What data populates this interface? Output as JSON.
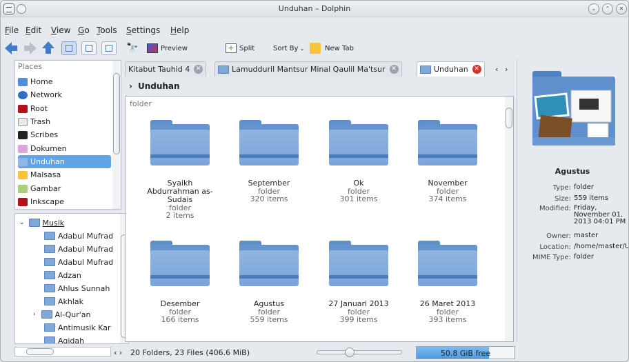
{
  "window": {
    "title": "Unduhan – Dolphin"
  },
  "menu": [
    "File",
    "Edit",
    "View",
    "Go",
    "Tools",
    "Settings",
    "Help"
  ],
  "toolbar": {
    "preview": "Preview",
    "split": "Split",
    "sort_by": "Sort By",
    "new_tab": "New Tab"
  },
  "places": {
    "header": "Places",
    "items": [
      {
        "label": "Home",
        "color": "#4f8fd9"
      },
      {
        "label": "Network",
        "color": "#2f6fc4"
      },
      {
        "label": "Root",
        "color": "#b3121a"
      },
      {
        "label": "Trash",
        "color": "#d9dde2"
      },
      {
        "label": "Scribes",
        "color": "#222222"
      },
      {
        "label": "Dokumen",
        "color": "#d9a6dc"
      },
      {
        "label": "Unduhan",
        "color": "#8fb6e6"
      },
      {
        "label": "Malsasa",
        "color": "#f5c33a"
      },
      {
        "label": "Gambar",
        "color": "#a8d07a"
      },
      {
        "label": "Inkscape",
        "color": "#b3121a"
      }
    ],
    "selected": "Unduhan"
  },
  "tree": {
    "root": "Musik",
    "children": [
      "Adabul Mufrad",
      "Adabul Mufrad",
      "Adabul Mufrad",
      "Adzan",
      "Ahlus Sunnah",
      "Akhlak",
      "Al-Qur'an",
      "Antimusik Kar",
      "Aqidah"
    ]
  },
  "tabs": [
    {
      "label": "Kitabut Tauhid 4",
      "active": false
    },
    {
      "label": "Lamudduril Mantsur Minal Qaulil Ma'tsur",
      "active": false
    },
    {
      "label": "Unduhan",
      "active": true
    }
  ],
  "breadcrumb": "Unduhan",
  "group_label": "folder",
  "folders": [
    {
      "name": "Syaikh Abdurrahman as-Sudais",
      "type": "folder",
      "count": "2 items"
    },
    {
      "name": "September",
      "type": "folder",
      "count": "320 items"
    },
    {
      "name": "Ok",
      "type": "folder",
      "count": "301 items"
    },
    {
      "name": "November",
      "type": "folder",
      "count": "374 items"
    },
    {
      "name": "Desember",
      "type": "folder",
      "count": "166 items"
    },
    {
      "name": "Agustus",
      "type": "folder",
      "count": "559 items"
    },
    {
      "name": "27 Januari 2013",
      "type": "folder",
      "count": "399 items"
    },
    {
      "name": "26 Maret 2013",
      "type": "folder",
      "count": "393 items"
    }
  ],
  "info": {
    "name": "Agustus",
    "type_k": "Type:",
    "type_v": "folder",
    "size_k": "Size:",
    "size_v": "559 items",
    "modified_k": "Modified:",
    "modified_v": "Friday, November 01, 2013 04:01 PM",
    "owner_k": "Owner:",
    "owner_v": "master",
    "location_k": "Location:",
    "location_v": "/home/master/Un",
    "mime_k": "MIME Type:",
    "mime_v": "folder"
  },
  "status": {
    "summary": "20 Folders, 23 Files (406.6 MiB)",
    "free_space": "50.8 GiB free",
    "used_fraction": 0.74
  }
}
